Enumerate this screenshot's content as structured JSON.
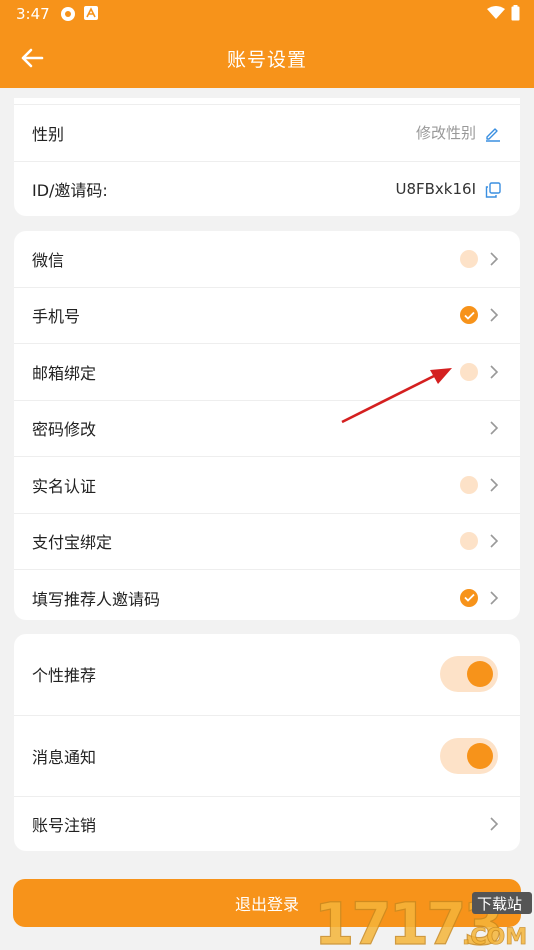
{
  "status_bar": {
    "time": "3:47"
  },
  "header": {
    "title": "账号设置"
  },
  "profile": {
    "gender_label": "性别",
    "gender_value": "修改性别",
    "id_label": "ID/邀请码:",
    "id_value": "U8FBxk16I"
  },
  "bindings": [
    {
      "label": "微信",
      "checked": false
    },
    {
      "label": "手机号",
      "checked": true
    },
    {
      "label": "邮箱绑定",
      "checked": false
    },
    {
      "label": "密码修改",
      "checked": null
    },
    {
      "label": "实名认证",
      "checked": false
    },
    {
      "label": "支付宝绑定",
      "checked": false
    },
    {
      "label": "填写推荐人邀请码",
      "checked": true
    }
  ],
  "settings": {
    "personal_recommend": "个性推荐",
    "personal_recommend_on": true,
    "notifications": "消息通知",
    "notifications_on": true,
    "cancel_account": "账号注销"
  },
  "logout_label": "退出登录",
  "watermark": {
    "number": "17173",
    "tag": "下载站",
    "domain": ".COM"
  },
  "colors": {
    "accent": "#f7931a",
    "accent_light": "#fde2c8",
    "background": "#f2f2f2"
  }
}
